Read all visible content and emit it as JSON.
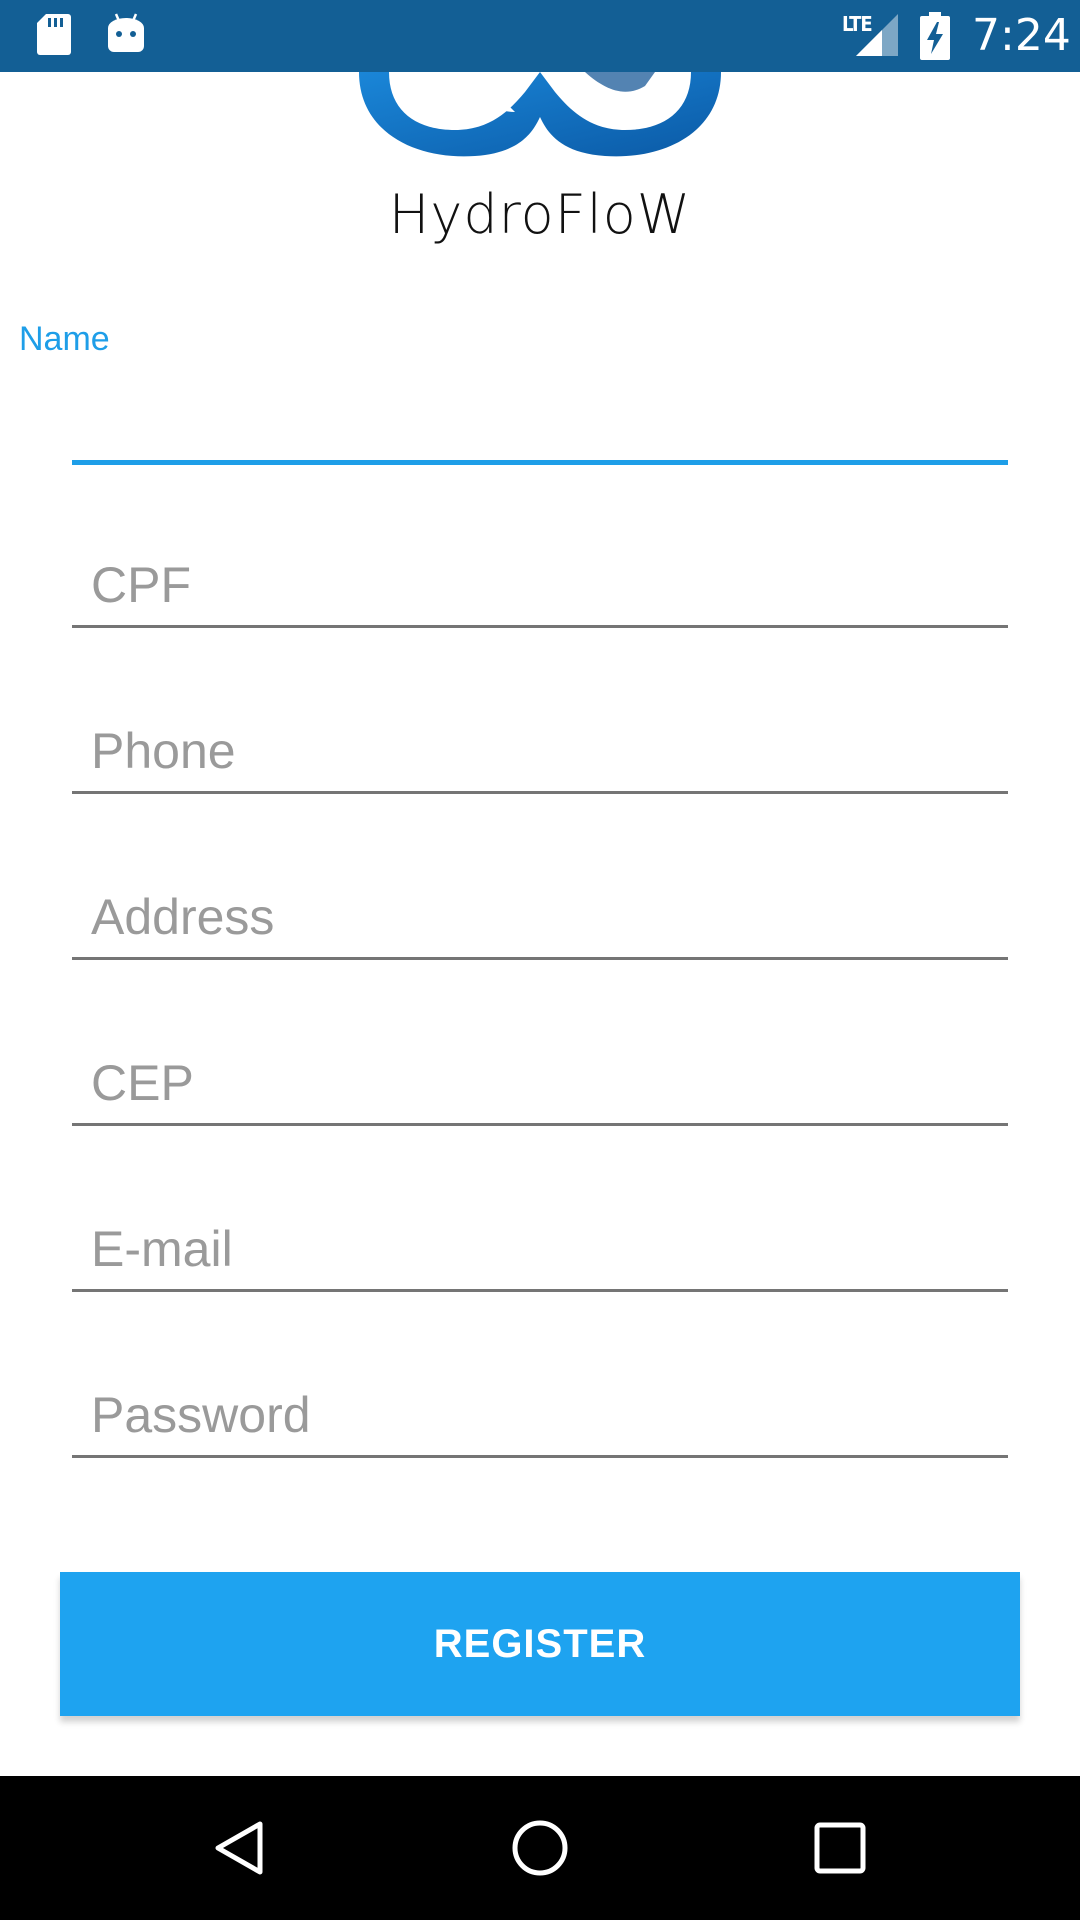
{
  "status_bar": {
    "time": "7:24",
    "network": "LTE",
    "icons": [
      "sd-card-icon",
      "android-notification-icon",
      "lte-signal-icon",
      "battery-charging-icon"
    ],
    "background_color": "#135f95"
  },
  "brand": {
    "name": "HydroFloW",
    "logo_color": "#1673c4"
  },
  "form": {
    "fields": [
      {
        "label": "Name",
        "placeholder": "",
        "value": "",
        "focused": true
      },
      {
        "label": "",
        "placeholder": "CPF",
        "value": ""
      },
      {
        "label": "",
        "placeholder": "Phone",
        "value": ""
      },
      {
        "label": "",
        "placeholder": "Address",
        "value": ""
      },
      {
        "label": "",
        "placeholder": "CEP",
        "value": ""
      },
      {
        "label": "",
        "placeholder": "E-mail",
        "value": ""
      },
      {
        "label": "",
        "placeholder": "Password",
        "value": ""
      }
    ],
    "accent_color": "#1e9ee8"
  },
  "register_button": {
    "label": "REGISTER",
    "color": "#1ea3f0"
  },
  "nav_bar": {
    "icons": [
      "back-icon",
      "home-icon",
      "recent-apps-icon"
    ]
  }
}
